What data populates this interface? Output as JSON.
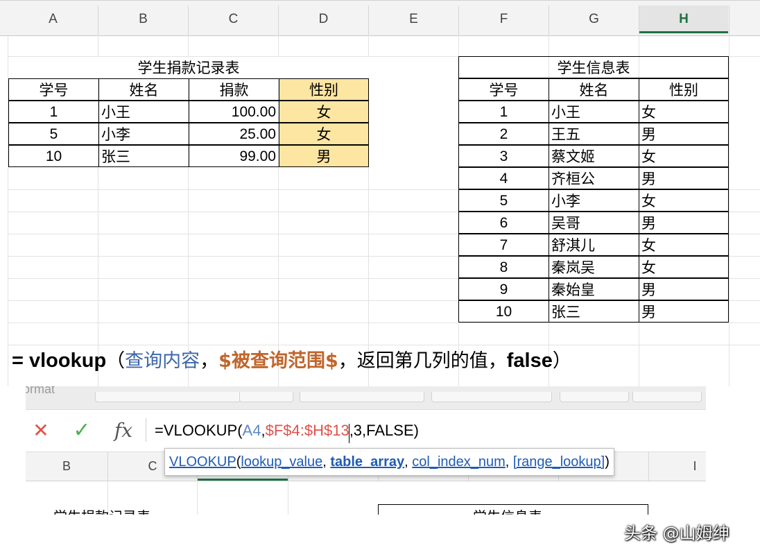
{
  "columns": [
    "A",
    "B",
    "C",
    "D",
    "E",
    "F",
    "G",
    "H"
  ],
  "active_column": "H",
  "donation_table": {
    "title": "学生捐款记录表",
    "headers": [
      "学号",
      "姓名",
      "捐款",
      "性别"
    ],
    "rows": [
      [
        "1",
        "小王",
        "100.00",
        "女"
      ],
      [
        "5",
        "小李",
        "25.00",
        "女"
      ],
      [
        "10",
        "张三",
        "99.00",
        "男"
      ]
    ]
  },
  "info_table": {
    "title": "学生信息表",
    "headers": [
      "学号",
      "姓名",
      "性别"
    ],
    "rows": [
      [
        "1",
        "小王",
        "女"
      ],
      [
        "2",
        "王五",
        "男"
      ],
      [
        "3",
        "蔡文姬",
        "女"
      ],
      [
        "4",
        "齐桓公",
        "男"
      ],
      [
        "5",
        "小李",
        "女"
      ],
      [
        "6",
        "吴哥",
        "男"
      ],
      [
        "7",
        "舒淇儿",
        "女"
      ],
      [
        "8",
        "秦岚吴",
        "女"
      ],
      [
        "9",
        "秦始皇",
        "男"
      ],
      [
        "10",
        "张三",
        "男"
      ]
    ]
  },
  "note": {
    "prefix": "= vlookup",
    "open": "（",
    "query": "查询内容",
    "comma1": "，",
    "range": "$被查询范围$",
    "comma2": "，",
    "col_text": "返回第几列的值，",
    "false_text": "false",
    "close": "）"
  },
  "second_shot": {
    "ribbon_fragment": "ormat",
    "col_b": "B",
    "col_c": "C",
    "col_i": "I",
    "cancel_symbol": "✕",
    "confirm_symbol": "✓",
    "fx_label": "fx",
    "formula": {
      "p1": "=VLOOKUP(",
      "a4": "A4",
      "comma": ",",
      "range": "$F$4:$H$13",
      "rest": ",3,FALSE)"
    },
    "tooltip": {
      "fn": "VLOOKUP",
      "open": "(",
      "arg1": "lookup_value",
      "sep": ", ",
      "arg2": "table_array",
      "arg3": "col_index_num",
      "arg4": "[range_lookup]",
      "close": ")"
    },
    "cut_text_left": "学生捐款记录表",
    "cut_text_right": "学生信息表"
  },
  "watermark": "头条 @山姆绅",
  "colors": {
    "accent_green": "#1e7145",
    "highlight": "#fde5a2",
    "query_blue": "#3c66a8",
    "range_orange": "#c0652b",
    "cancel_red": "#e0524b",
    "confirm_green": "#4caf50"
  }
}
